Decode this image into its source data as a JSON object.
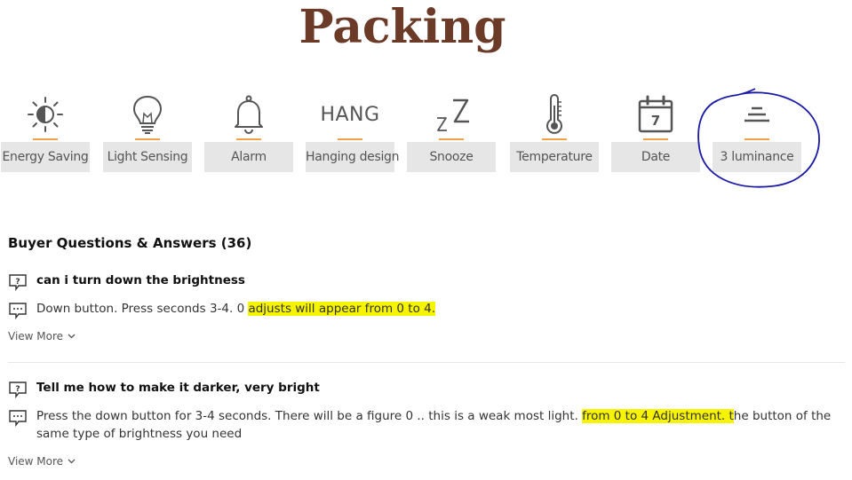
{
  "header": {
    "title": "Packing"
  },
  "features": [
    {
      "label": "Energy Saving",
      "icon": "sun-half-icon"
    },
    {
      "label": "Light Sensing",
      "icon": "light-bulb-icon"
    },
    {
      "label": "Alarm",
      "icon": "bell-icon"
    },
    {
      "label": "Hanging design",
      "icon": "hang-text-icon",
      "icon_text": "HANG"
    },
    {
      "label": "Snooze",
      "icon": "zz-icon",
      "icon_text": "zZ"
    },
    {
      "label": "Temperature",
      "icon": "thermometer-icon"
    },
    {
      "label": "Date",
      "icon": "calendar-icon",
      "icon_text": "7"
    },
    {
      "label": "3 luminance",
      "icon": "luminance-levels-icon"
    }
  ],
  "qa": {
    "title": "Buyer Questions & Answers (36)",
    "items": [
      {
        "question": "can i turn down the brightness",
        "answer_plain": "Down button. Press seconds 3-4. 0 ",
        "answer_highlight": "adjusts will appear from 0 to 4.",
        "answer_rest": "",
        "view_more": "View More"
      },
      {
        "question": "Tell me how to make it darker, very bright",
        "answer_plain": "Press the down button for 3-4 seconds. There will be a figure 0 .. this is a weak most light. ",
        "answer_highlight": "from 0 to 4 Adjustment. t",
        "answer_rest": "he button of the same type of brightness you need",
        "view_more": "View More"
      }
    ]
  },
  "colors": {
    "title": "#6b3b28",
    "accent_bar": "#f2a048",
    "label_bg": "#e6e6e6",
    "highlight": "#f6f400",
    "annotation": "#1a1aa8"
  }
}
